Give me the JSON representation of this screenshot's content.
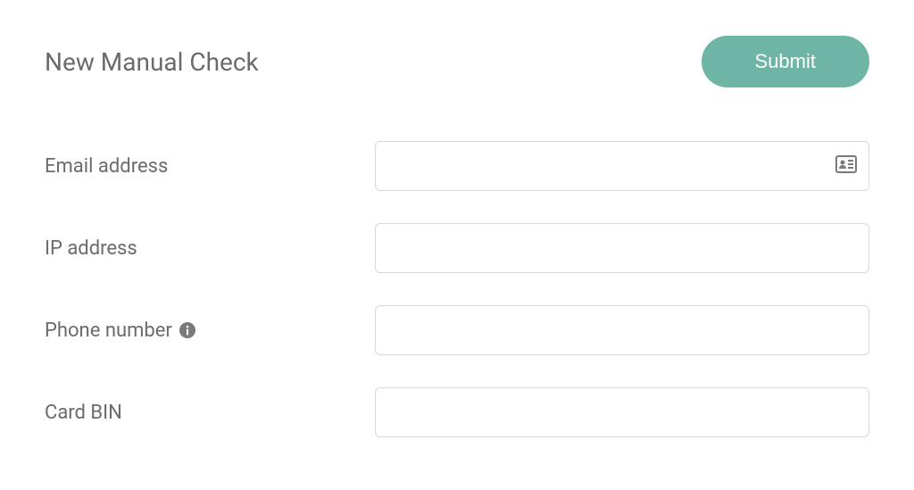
{
  "header": {
    "title": "New Manual Check",
    "submit_label": "Submit"
  },
  "form": {
    "fields": [
      {
        "label": "Email address",
        "value": "",
        "has_info": false,
        "has_contact_icon": true
      },
      {
        "label": "IP address",
        "value": "",
        "has_info": false,
        "has_contact_icon": false
      },
      {
        "label": "Phone number",
        "value": "",
        "has_info": true,
        "has_contact_icon": false
      },
      {
        "label": "Card BIN",
        "value": "",
        "has_info": false,
        "has_contact_icon": false
      }
    ]
  },
  "icons": {
    "info": "info-circle-icon",
    "contact": "id-card-icon"
  }
}
